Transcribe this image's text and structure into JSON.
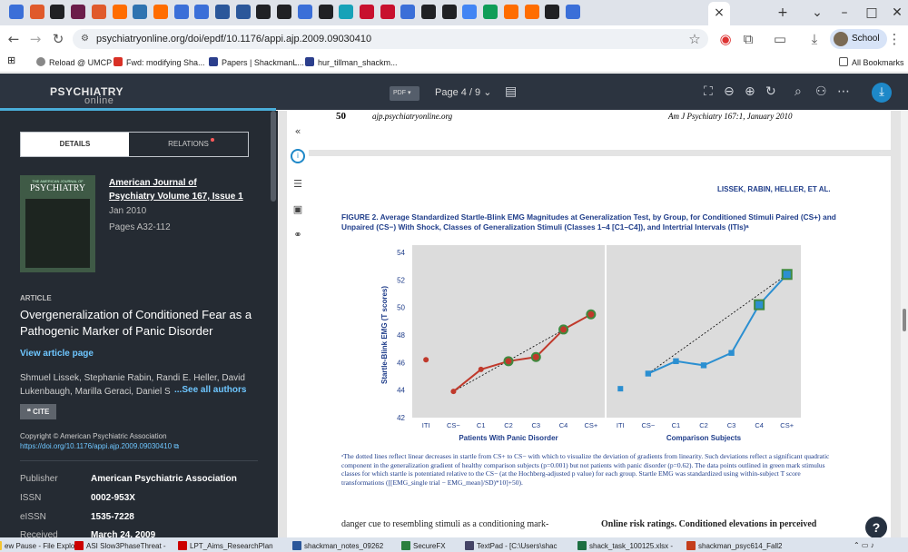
{
  "browser": {
    "tab_icon_colors": [
      "#3b6fd8",
      "#e05a2b",
      "#202124",
      "#6b1d4a",
      "#e05a2b",
      "#ff6d00",
      "#2f73b0",
      "#ff6d00",
      "#3b6fd8",
      "#3b6fd8",
      "#2b579a",
      "#2b579a",
      "#202124",
      "#202124",
      "#3b6fd8",
      "#202124",
      "#17a2b8",
      "#c8102e",
      "#c8102e",
      "#3b6fd8",
      "#202124",
      "#202124",
      "#4285f4",
      "#0f9d58",
      "#ff6d00",
      "#ff6d00",
      "#202124",
      "#3b6fd8"
    ],
    "tab_labels": [
      "E",
      "E",
      "JN",
      "JN",
      "E",
      "E",
      "E",
      "E"
    ],
    "close_tab_icon": "close-icon",
    "new_tab_icon": "plus-icon",
    "window_controls": [
      "chevron-down-icon",
      "minimize-icon",
      "maximize-icon",
      "close-icon"
    ],
    "url": "psychiatryonline.org/doi/epdf/10.1176/appi.ajp.2009.09030410",
    "profile_label": "School",
    "bookmarks": [
      "Reload @ UMCP",
      "Fwd: modifying Sha...",
      "Papers | ShackmanL...",
      "hur_tillman_shackm..."
    ],
    "all_bookmarks": "All Bookmarks"
  },
  "toolbar": {
    "brand_top": "PSYCHIATRY",
    "brand_bottom": "online",
    "pdf_label": "PDF",
    "page_label": "Page 4 / 9",
    "reading_progress": 0.44
  },
  "sidebar": {
    "tab_details": "DETAILS",
    "tab_relations": "RELATIONS",
    "cover_line1": "THE AMERICAN JOURNAL OF",
    "cover_line2": "PSYCHIATRY",
    "journal_title": "American Journal of Psychiatry Volume 167, Issue 1",
    "date": "Jan 2010",
    "pages": "Pages  A32-112",
    "article_label": "ARTICLE",
    "article_title": "Overgeneralization of Conditioned Fear as a Pathogenic Marker of Panic Disorder",
    "view_link": "View article page",
    "authors": "Shmuel Lissek, Stephanie Rabin, Randi E. Heller, David Lukenbaugh, Marilla Geraci, Daniel S",
    "see_all": "...See all authors",
    "cite": "CITE",
    "copyright": "Copyright © American Psychiatric Association",
    "doi": "https://doi.org/10.1176/appi.ajp.2009.09030410",
    "meta": [
      {
        "k": "Publisher",
        "v": "American Psychiatric Association"
      },
      {
        "k": "ISSN",
        "v": "0002-953X"
      },
      {
        "k": "eISSN",
        "v": "1535-7228"
      },
      {
        "k": "Received",
        "v": "March 24, 2009"
      }
    ]
  },
  "page": {
    "prev_number": "50",
    "prev_url": "ajp.psychiatryonline.org",
    "prev_journal": "Am J Psychiatry 167:1, January 2010",
    "running_head": "LISSEK, RABIN, HELLER, ET AL.",
    "figure_caption": "FIGURE 2. Average Standardized Startle-Blink EMG Magnitudes at Generalization Test, by Group, for Conditioned Stimuli Paired (CS+) and Unpaired (CS−) With Shock, Classes of Generalization Stimuli (Classes 1–4 [C1–C4]), and Intertrial Intervals (ITIs)ᵃ",
    "footnote": "ᵃThe dotted lines reflect linear decreases in startle from CS+ to CS− with which to visualize the deviation of gradients from linearity. Such deviations reflect a significant quadratic component in the generalization gradient of healthy comparison subjects (p=0.001) but not patients with panic disorder (p=0.62). The data points outlined in green mark stimulus classes for which startle is potentiated relative to the CS− (at the Hochberg-adjusted p value) for each group. Startle EMG was standardized using within-subject T score transformations ([[EMG_single trial − EMG_mean]/SD)*10]+50).",
    "body_left": "danger cue to resembling stimuli as a conditioning mark-",
    "body_right": "Online risk ratings. Conditioned elevations in perceived"
  },
  "chart_data": {
    "type": "line",
    "ylabel": "Startle-Blink EMG (T scores)",
    "ylim": [
      42,
      54
    ],
    "yticks": [
      42,
      44,
      46,
      48,
      50,
      52,
      54
    ],
    "categories": [
      "ITI",
      "CS−",
      "C1",
      "C2",
      "C3",
      "C4",
      "CS+"
    ],
    "panels": [
      {
        "xlabel": "Patients With Panic Disorder",
        "color": "#c0392b",
        "marker": "circle",
        "iti": 46.2,
        "values": [
          43.9,
          45.5,
          46.1,
          46.4,
          48.4,
          49.5
        ],
        "green_outlined": [
          false,
          false,
          true,
          true,
          true,
          true
        ]
      },
      {
        "xlabel": "Comparison Subjects",
        "color": "#2b8fd1",
        "marker": "square",
        "iti": 44.1,
        "values": [
          45.2,
          46.1,
          45.8,
          46.7,
          50.2,
          52.4
        ],
        "green_outlined": [
          false,
          false,
          false,
          false,
          true,
          true
        ]
      }
    ]
  },
  "taskbar": [
    "ew Pause - File Explor",
    "ASI Slow3PhaseThreat -",
    "LPT_Aims_ResearchPlan",
    "shackman_notes_09262",
    "SecureFX",
    "TextPad - [C:\\Users\\shac",
    "shack_task_100125.xlsx -",
    "shackman_psyc614_Fall2"
  ]
}
